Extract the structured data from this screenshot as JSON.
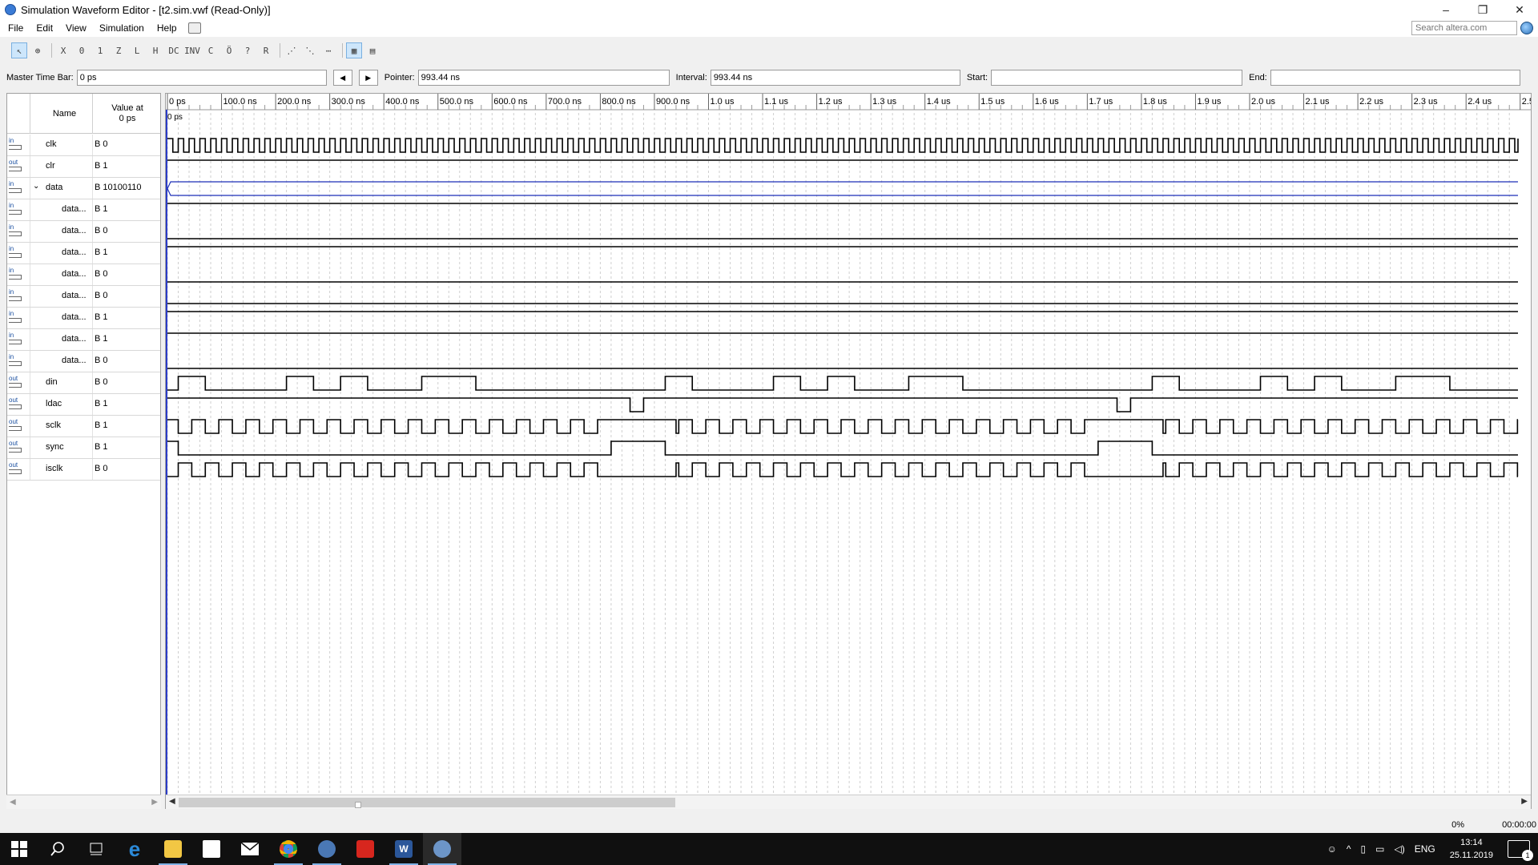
{
  "window": {
    "title": "Simulation Waveform Editor - [t2.sim.vwf (Read-Only)]",
    "controls": [
      "–",
      "❐",
      "✕"
    ]
  },
  "menu": {
    "items": [
      "File",
      "Edit",
      "View",
      "Simulation",
      "Help"
    ],
    "search_placeholder": "Search altera.com"
  },
  "toolbar": {
    "buttons": [
      {
        "icon": "selection-tool-icon",
        "glyph": "↖",
        "active": true
      },
      {
        "icon": "zoom-tool-icon",
        "glyph": "⊕"
      },
      {
        "icon": "forcing-unknown-icon",
        "glyph": "X"
      },
      {
        "icon": "forcing-low-icon",
        "glyph": "0"
      },
      {
        "icon": "forcing-high-icon",
        "glyph": "1"
      },
      {
        "icon": "high-impedance-icon",
        "glyph": "Z"
      },
      {
        "icon": "weak-low-icon",
        "glyph": "L"
      },
      {
        "icon": "weak-high-icon",
        "glyph": "H"
      },
      {
        "icon": "dont-care-icon",
        "glyph": "DC"
      },
      {
        "icon": "invert-icon",
        "glyph": "INV"
      },
      {
        "icon": "count-value-icon",
        "glyph": "C"
      },
      {
        "icon": "clock-value-icon",
        "glyph": "Ö"
      },
      {
        "icon": "arbitrary-value-icon",
        "glyph": "?"
      },
      {
        "icon": "random-value-icon",
        "glyph": "R"
      },
      {
        "icon": "snap-to-grid-icon",
        "glyph": "⋰"
      },
      {
        "icon": "snap-transition-icon",
        "glyph": "⋱"
      },
      {
        "icon": "grid-icon",
        "glyph": "⋯"
      },
      {
        "icon": "run-functional-icon",
        "glyph": "▦",
        "active": true
      },
      {
        "icon": "run-timing-icon",
        "glyph": "▤"
      }
    ]
  },
  "timebar": {
    "master_label": "Master Time Bar:",
    "master_value": "0 ps",
    "pointer_label": "Pointer:",
    "pointer_value": "993.44 ns",
    "interval_label": "Interval:",
    "interval_value": "993.44 ns",
    "start_label": "Start:",
    "start_value": "",
    "end_label": "End:",
    "end_value": ""
  },
  "signals": {
    "header_name": "Name",
    "header_value_1": "Value at",
    "header_value_2": "0 ps",
    "rows": [
      {
        "dir": "in",
        "name": "clk",
        "value": "B 0",
        "indent": 0
      },
      {
        "dir": "out",
        "name": "clr",
        "value": "B 1",
        "indent": 0
      },
      {
        "dir": "in",
        "name": "data",
        "value": "B 10100110",
        "indent": 0,
        "expanded": true
      },
      {
        "dir": "in",
        "name": "data...",
        "value": "B 1",
        "indent": 1
      },
      {
        "dir": "in",
        "name": "data...",
        "value": "B 0",
        "indent": 1
      },
      {
        "dir": "in",
        "name": "data...",
        "value": "B 1",
        "indent": 1
      },
      {
        "dir": "in",
        "name": "data...",
        "value": "B 0",
        "indent": 1
      },
      {
        "dir": "in",
        "name": "data...",
        "value": "B 0",
        "indent": 1
      },
      {
        "dir": "in",
        "name": "data...",
        "value": "B 1",
        "indent": 1
      },
      {
        "dir": "in",
        "name": "data...",
        "value": "B 1",
        "indent": 1
      },
      {
        "dir": "in",
        "name": "data...",
        "value": "B 0",
        "indent": 1
      },
      {
        "dir": "out",
        "name": "din",
        "value": "B 0",
        "indent": 0
      },
      {
        "dir": "out",
        "name": "ldac",
        "value": "B 1",
        "indent": 0
      },
      {
        "dir": "out",
        "name": "sclk",
        "value": "B 1",
        "indent": 0
      },
      {
        "dir": "out",
        "name": "sync",
        "value": "B 1",
        "indent": 0
      },
      {
        "dir": "out",
        "name": "isclk",
        "value": "B 0",
        "indent": 0
      }
    ]
  },
  "timeline": {
    "ticks": [
      "0 ps",
      "100.0 ns",
      "200.0 ns",
      "300.0 ns",
      "400.0 ns",
      "500.0 ns",
      "600.0 ns",
      "700.0 ns",
      "800.0 ns",
      "900.0 ns",
      "1.0 us",
      "1.1 us",
      "1.2 us",
      "1.3 us",
      "1.4 us",
      "1.5 us",
      "1.6 us",
      "1.7 us",
      "1.8 us",
      "1.9 us",
      "2.0 us",
      "2.1 us",
      "2.2 us",
      "2.3 us",
      "2.4 us",
      "2.5"
    ],
    "cursor_label": "0 ps",
    "visible_range_ns": [
      0,
      2500
    ],
    "waves": {
      "clk": {
        "type": "clock",
        "period_ns": 20,
        "start": 0
      },
      "clr": {
        "type": "const",
        "level": 1
      },
      "data": {
        "type": "bus"
      },
      "data7": {
        "type": "const",
        "level": 1
      },
      "data6": {
        "type": "const",
        "level": 0
      },
      "data5": {
        "type": "const",
        "level": 1
      },
      "data4": {
        "type": "const",
        "level": 0
      },
      "data3": {
        "type": "const",
        "level": 0
      },
      "data2": {
        "type": "const",
        "level": 1
      },
      "data1": {
        "type": "const",
        "level": 1
      },
      "data0": {
        "type": "const",
        "level": 0
      },
      "din": {
        "type": "pulses",
        "highs": [
          [
            20,
            70
          ],
          [
            220,
            270
          ],
          [
            320,
            370
          ],
          [
            470,
            570
          ],
          [
            920,
            970
          ],
          [
            1120,
            1170
          ],
          [
            1220,
            1270
          ],
          [
            1370,
            1470
          ],
          [
            1820,
            1870
          ],
          [
            2020,
            2070
          ],
          [
            2120,
            2170
          ],
          [
            2270,
            2370
          ]
        ]
      },
      "ldac": {
        "type": "pulses_low",
        "lows": [
          [
            855,
            880
          ],
          [
            1755,
            1780
          ]
        ]
      },
      "sclk": {
        "type": "clock_gap",
        "period_ns": 50,
        "start": 20,
        "gaps": [
          [
            820,
            940
          ],
          [
            1720,
            1840
          ]
        ],
        "gap_level": 1
      },
      "sync": {
        "type": "pulses",
        "highs": [
          [
            0,
            20
          ],
          [
            820,
            920
          ],
          [
            1720,
            1820
          ]
        ]
      },
      "isclk": {
        "type": "clock_gap",
        "period_ns": 50,
        "start": 20,
        "gaps": [
          [
            820,
            940
          ],
          [
            1720,
            1840
          ]
        ],
        "gap_level": 0,
        "invert": true
      }
    }
  },
  "status": {
    "percent": "0%",
    "elapsed": "00:00:00"
  },
  "taskbar": {
    "clock_time": "13:14",
    "clock_date": "25.11.2019",
    "lang": "ENG",
    "notif_count": "1",
    "apps": [
      "start-button",
      "search-icon",
      "task-view-icon",
      "edge-icon",
      "file-explorer-icon",
      "store-icon",
      "mail-icon",
      "chrome-icon",
      "quartus-icon",
      "acrobat-icon",
      "word-icon",
      "quartus-sim-icon"
    ]
  }
}
